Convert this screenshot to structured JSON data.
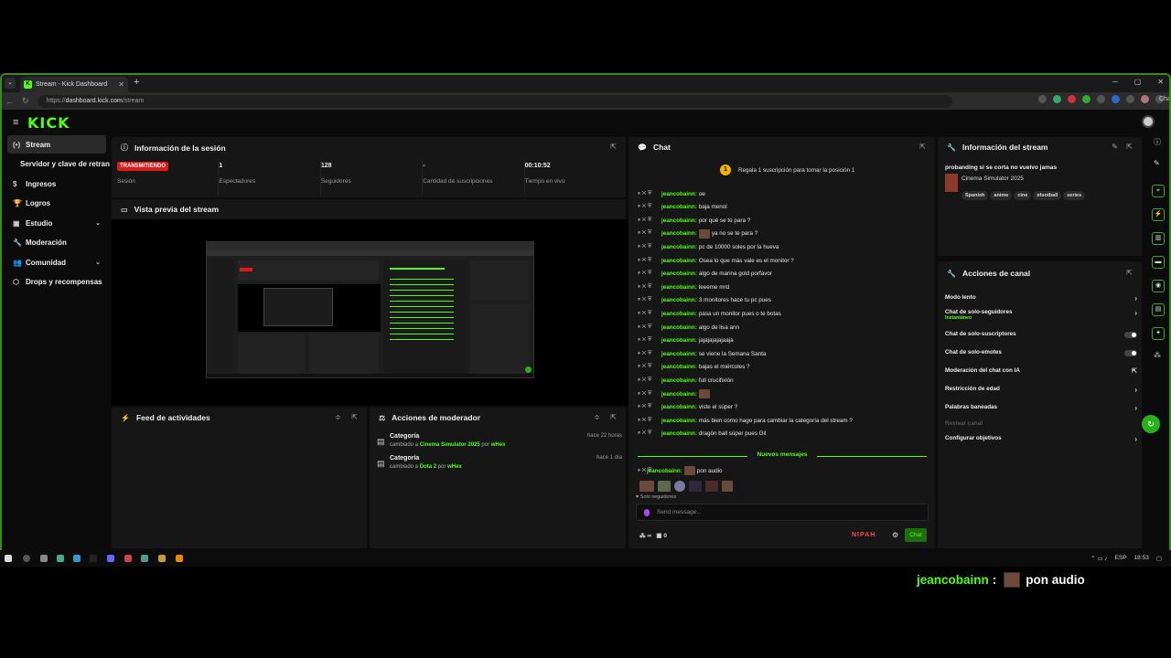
{
  "browser": {
    "tab_title": "Stream - Kick Dashboard",
    "url_scheme": "https://",
    "url_host": "dashboard.kick.com",
    "url_path": "/stream",
    "chat_pill": "Chat"
  },
  "app": {
    "logo": "KICK"
  },
  "sidebar": {
    "items": [
      {
        "icon": "(•)",
        "label": "Stream"
      },
      {
        "icon": "",
        "label": "Servidor y clave de retransmisión"
      },
      {
        "icon": "$",
        "label": "Ingresos"
      },
      {
        "icon": "🏆",
        "label": "Logros"
      },
      {
        "icon": "▣",
        "label": "Estudio"
      },
      {
        "icon": "🔧",
        "label": "Moderación"
      },
      {
        "icon": "👥",
        "label": "Comunidad"
      },
      {
        "icon": "⬡",
        "label": "Drops y recompensas"
      }
    ]
  },
  "session": {
    "title": "Información de la sesión",
    "live_badge": "TRANSMITIENDO",
    "stats": [
      {
        "value": "",
        "label": "Sesión"
      },
      {
        "value": "1",
        "label": "Espectadores"
      },
      {
        "value": "128",
        "label": "Seguidores"
      },
      {
        "value": "-",
        "label": "Cantidad de suscripciones"
      },
      {
        "value": "00:10:52",
        "label": "Tiempo en vivo"
      }
    ]
  },
  "preview": {
    "title": "Vista previa del stream"
  },
  "feed": {
    "title": "Feed de actividades"
  },
  "modactions": {
    "title": "Acciones de moderador",
    "rows": [
      {
        "title": "Categoría",
        "pre": "cambiado a",
        "value": "Cinema Simulator 2025",
        "by": "por",
        "user": "wHex",
        "time": "hace 22 horas"
      },
      {
        "title": "Categoría",
        "pre": "cambiado a",
        "value": "Dota 2",
        "by": "por",
        "user": "wHex",
        "time": "hace 1 día"
      }
    ]
  },
  "chat": {
    "title": "Chat",
    "pinned": "Regala 1 suscripción para tomar la posición 1",
    "messages": [
      {
        "user": "jeancobainn:",
        "text": "oe",
        "emote": false
      },
      {
        "user": "jeancobainn:",
        "text": "baja menol",
        "emote": false
      },
      {
        "user": "jeancobainn:",
        "text": "por qué se te para ?",
        "emote": false
      },
      {
        "user": "jeancobainn:",
        "text": "ya no se te para ?",
        "emote": true
      },
      {
        "user": "jeancobainn:",
        "text": "pc de 10000 soles por la hueva",
        "emote": false
      },
      {
        "user": "jeancobainn:",
        "text": "Osea lo que más vale es el monitor ?",
        "emote": false
      },
      {
        "user": "jeancobainn:",
        "text": "algo de marina gold porfavor",
        "emote": false
      },
      {
        "user": "jeancobainn:",
        "text": "leeeme mrd",
        "emote": false
      },
      {
        "user": "jeancobainn:",
        "text": "3 monitores hace tu pc pues",
        "emote": false
      },
      {
        "user": "jeancobainn:",
        "text": "pasa un monitor pues o te botas",
        "emote": false
      },
      {
        "user": "jeancobainn:",
        "text": "algo de lisa ann",
        "emote": false
      },
      {
        "user": "jeancobainn:",
        "text": "jajajajajajaaja",
        "emote": false
      },
      {
        "user": "jeancobainn:",
        "text": "se viene la Semana Santa",
        "emote": false
      },
      {
        "user": "jeancobainn:",
        "text": "bajas el miércoles ?",
        "emote": false
      },
      {
        "user": "jeancobainn:",
        "text": "full crucifixión",
        "emote": false
      },
      {
        "user": "jeancobainn:",
        "text": "",
        "emote": true
      },
      {
        "user": "jeancobainn:",
        "text": "viste el súper ?",
        "emote": false
      },
      {
        "user": "jeancobainn:",
        "text": "más bien como hago para cambiar la categoría del stream ?",
        "emote": false
      },
      {
        "user": "jeancobainn:",
        "text": "dragón ball súper pues Gil",
        "emote": false
      }
    ],
    "new_messages_label": "Nuevos mensajes",
    "last_message": {
      "user": "jeancobainn:",
      "text": "pon audio"
    },
    "followers_only": "Solo seguidores",
    "input_placeholder": "Send message...",
    "footer_count_a": "∞",
    "footer_count_b": "0",
    "nipah": "NIPAH",
    "send_button": "Chat"
  },
  "streaminfo": {
    "title": "Información del stream",
    "stream_title": "probanding si se corta no vuelvo jamas",
    "category": "Cinema Simulator 2025",
    "tags": [
      "Spanish",
      "anime",
      "cine",
      "efootball",
      "series"
    ]
  },
  "channel_actions": {
    "title": "Acciones de canal",
    "items": [
      {
        "label": "Modo lento",
        "sub": "",
        "control": "chevron"
      },
      {
        "label": "Chat de solo-seguidores",
        "sub": "Instantáneo",
        "control": "chevron"
      },
      {
        "label": "Chat de solo-suscriptores",
        "sub": "",
        "control": "toggle"
      },
      {
        "label": "Chat de solo-emotes",
        "sub": "",
        "control": "toggle"
      },
      {
        "label": "Moderación del chat con IA",
        "sub": "",
        "control": "external"
      },
      {
        "label": "Restricción de edad",
        "sub": "",
        "control": "chevron"
      },
      {
        "label": "Palabras baneadas",
        "sub": "",
        "control": "chevron"
      },
      {
        "label": "Restear canal",
        "sub": "",
        "control": "none"
      },
      {
        "label": "Configurar objetivos",
        "sub": "",
        "control": "chevron"
      }
    ]
  },
  "taskbar": {
    "lang": "ESP",
    "time": "18:53"
  },
  "overlay": {
    "user": "jeancobainn",
    "colon": ":",
    "message": "pon audio"
  },
  "colors": {
    "accent": "#53fc18",
    "live": "#e11919",
    "bg": "#0b0b0b",
    "panel": "#161616"
  }
}
